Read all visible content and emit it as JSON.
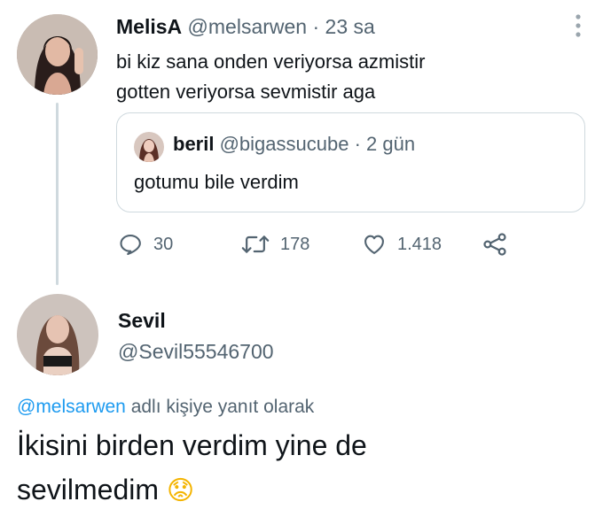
{
  "parent_tweet": {
    "display_name": "MelisA",
    "handle": "@melsarwen",
    "separator": "·",
    "time": "23 sa",
    "text_line1": "bi kiz sana onden veriyorsa azmistir",
    "text_line2": "gotten veriyorsa sevmistir aga",
    "more_icon": "more-vertical-icon",
    "quoted": {
      "display_name": "beril",
      "handle": "@bigassucube",
      "separator": "·",
      "time": "2 gün",
      "text": "gotumu bile verdim"
    },
    "actions": {
      "replies": "30",
      "retweets": "178",
      "likes": "1.418"
    }
  },
  "reply_tweet": {
    "display_name": "Sevil",
    "handle": "@Sevil55546700",
    "reply_to_handle": "@melsarwen",
    "reply_to_suffix": "adlı kişiye yanıt olarak",
    "text_line1": "İkisini birden verdim yine de",
    "text_line2": "sevilmedim",
    "emoji": "😟"
  },
  "colors": {
    "link": "#1d9bf0",
    "muted": "#536471",
    "thread_line": "#cfd9de",
    "border": "#cfd9de"
  }
}
